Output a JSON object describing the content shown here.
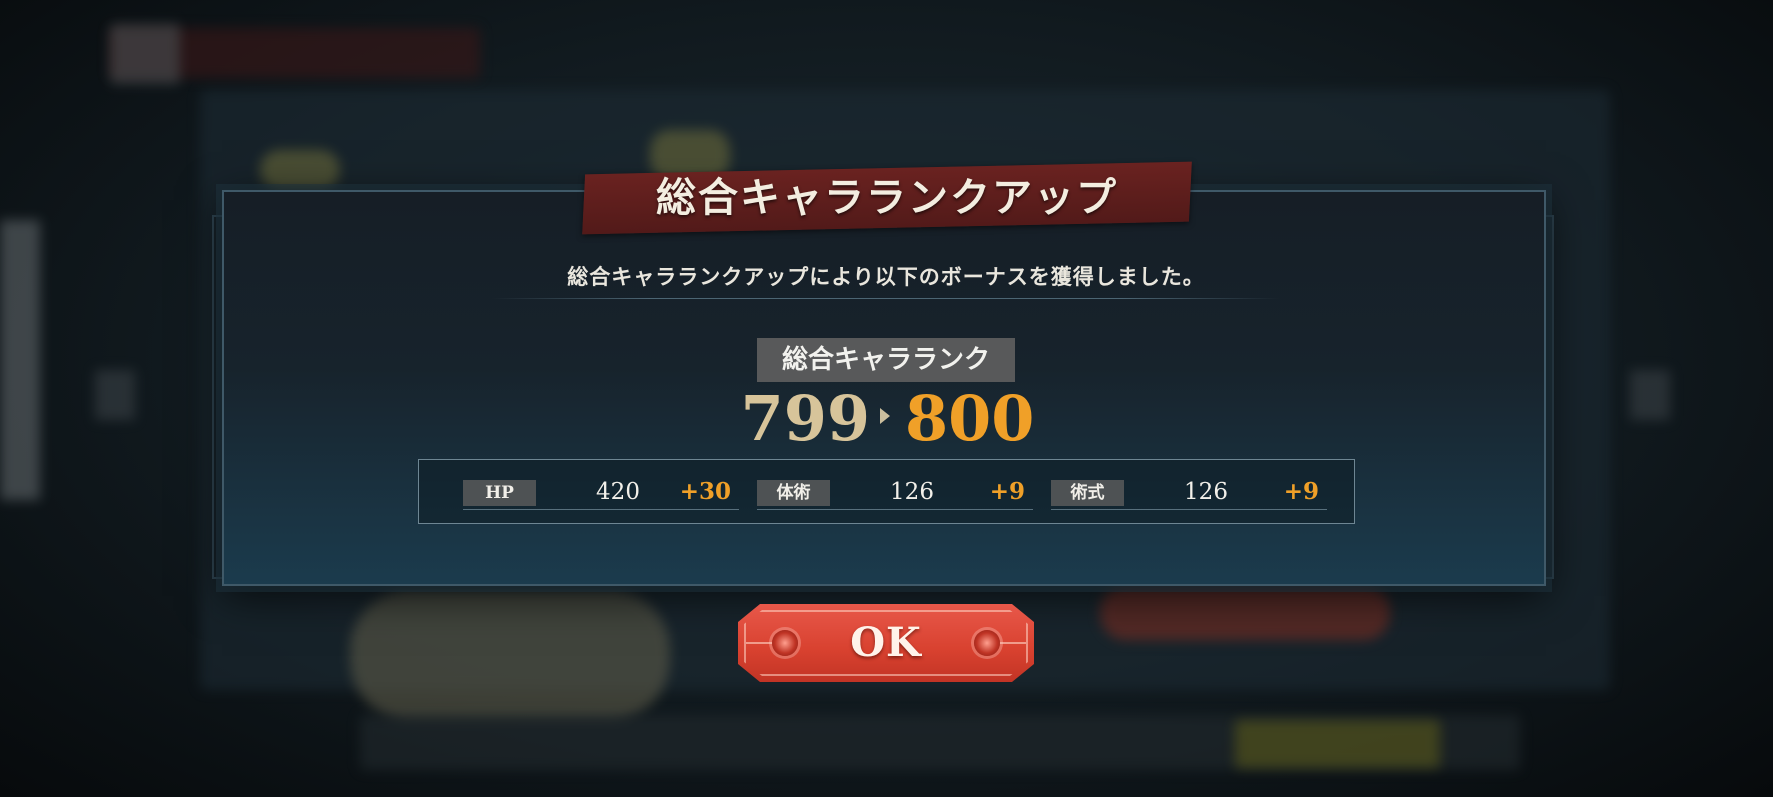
{
  "dialog": {
    "title": "総合キャラランクアップ",
    "message": "総合キャラランクアップにより以下のボーナスを獲得しました。",
    "rank": {
      "label": "総合キャラランク",
      "old": "799",
      "new": "800"
    },
    "stats": [
      {
        "name": "HP",
        "value": "420",
        "bonus": "+30"
      },
      {
        "name": "体術",
        "value": "126",
        "bonus": "+9"
      },
      {
        "name": "術式",
        "value": "126",
        "bonus": "+9"
      }
    ],
    "ok_label": "OK"
  },
  "colors": {
    "accent_orange": "#f0a028",
    "banner_red": "#6a2220",
    "button_red": "#d8412f",
    "old_rank_gold": "#d7c49a"
  }
}
